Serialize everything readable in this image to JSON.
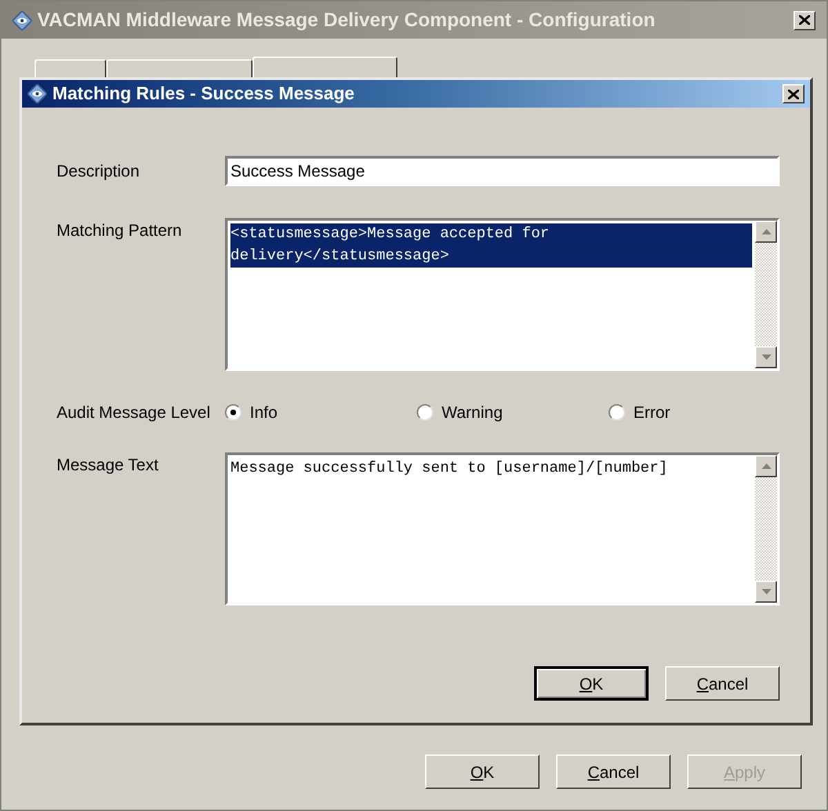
{
  "window": {
    "title": "VACMAN Middleware Message Delivery Component - Configuration",
    "active": false
  },
  "tabs": [
    {
      "selected": false
    },
    {
      "selected": false
    },
    {
      "selected": true
    }
  ],
  "dialog": {
    "title": "Matching Rules - Success Message",
    "active": true,
    "description": {
      "label": "Description",
      "value": "Success Message"
    },
    "matching_pattern": {
      "label": "Matching Pattern",
      "value": "<statusmessage>Message accepted for delivery</statusmessage>",
      "text_selected": true
    },
    "audit_level": {
      "label": "Audit Message Level",
      "options": [
        {
          "label": "Info",
          "selected": true
        },
        {
          "label": "Warning",
          "selected": false
        },
        {
          "label": "Error",
          "selected": false
        }
      ]
    },
    "message_text": {
      "label": "Message Text",
      "value": "Message successfully sent to [username]/[number]",
      "text_selected": false
    },
    "buttons": [
      {
        "label": "OK",
        "default": true,
        "disabled": false
      },
      {
        "label": "Cancel",
        "default": false,
        "disabled": false
      }
    ]
  },
  "buttons": [
    {
      "label": "OK",
      "default": false,
      "disabled": false
    },
    {
      "label": "Cancel",
      "default": false,
      "disabled": false
    },
    {
      "label": "Apply",
      "default": false,
      "disabled": true
    }
  ]
}
